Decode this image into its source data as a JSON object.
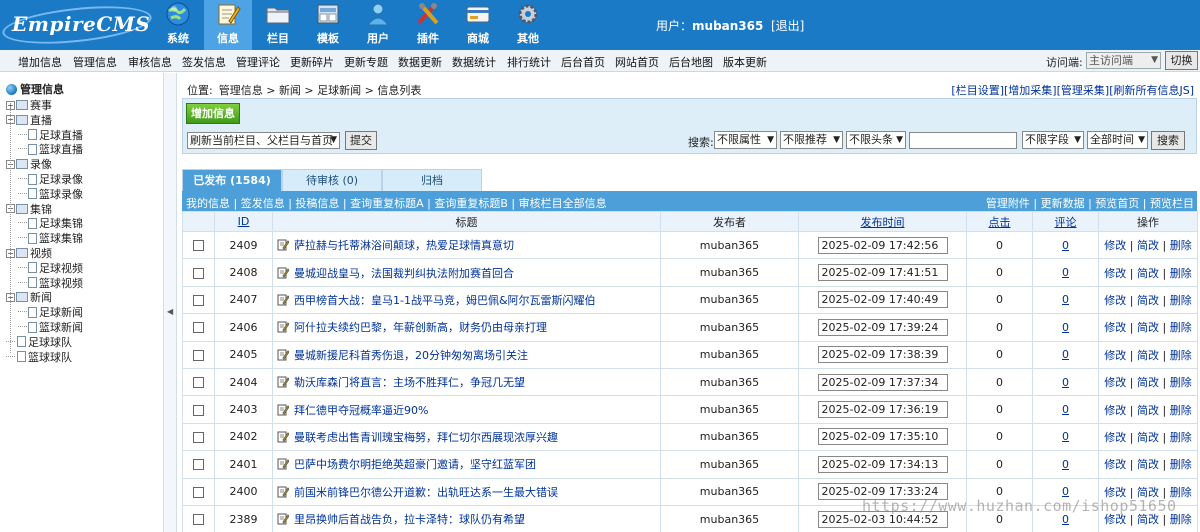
{
  "header": {
    "logo": "EmpireCMS",
    "tabs": [
      {
        "label": "系统",
        "icon": "globe-icon"
      },
      {
        "label": "信息",
        "icon": "notepad-icon"
      },
      {
        "label": "栏目",
        "icon": "folder-icon"
      },
      {
        "label": "模板",
        "icon": "template-icon"
      },
      {
        "label": "用户",
        "icon": "user-icon"
      },
      {
        "label": "插件",
        "icon": "tools-icon"
      },
      {
        "label": "商城",
        "icon": "card-icon"
      },
      {
        "label": "其他",
        "icon": "gear-icon"
      }
    ],
    "user_prefix": "用户：",
    "username": "muban365",
    "logout": "[退出]"
  },
  "menubar": {
    "items": [
      "增加信息",
      "管理信息",
      "审核信息",
      "签发信息",
      "管理评论",
      "更新碎片",
      "更新专题",
      "数据更新",
      "数据统计",
      "排行统计",
      "后台首页",
      "网站首页",
      "后台地图",
      "版本更新"
    ],
    "visit_label": "访问端:",
    "visit_value": "主访问端",
    "switch_label": "切换"
  },
  "sidebar": {
    "root": "管理信息",
    "nodes": [
      {
        "label": "赛事",
        "level": 0,
        "type": "folder-plus"
      },
      {
        "label": "直播",
        "level": 0,
        "type": "folder-minus"
      },
      {
        "label": "足球直播",
        "level": 1,
        "type": "doc"
      },
      {
        "label": "篮球直播",
        "level": 1,
        "type": "doc"
      },
      {
        "label": "录像",
        "level": 0,
        "type": "folder-minus"
      },
      {
        "label": "足球录像",
        "level": 1,
        "type": "doc"
      },
      {
        "label": "篮球录像",
        "level": 1,
        "type": "doc"
      },
      {
        "label": "集锦",
        "level": 0,
        "type": "folder-minus"
      },
      {
        "label": "足球集锦",
        "level": 1,
        "type": "doc"
      },
      {
        "label": "篮球集锦",
        "level": 1,
        "type": "doc"
      },
      {
        "label": "视频",
        "level": 0,
        "type": "folder-minus"
      },
      {
        "label": "足球视频",
        "level": 1,
        "type": "doc"
      },
      {
        "label": "篮球视频",
        "level": 1,
        "type": "doc"
      },
      {
        "label": "新闻",
        "level": 0,
        "type": "folder-minus"
      },
      {
        "label": "足球新闻",
        "level": 1,
        "type": "doc"
      },
      {
        "label": "篮球新闻",
        "level": 1,
        "type": "doc"
      },
      {
        "label": "足球球队",
        "level": 0,
        "type": "doc"
      },
      {
        "label": "篮球球队",
        "level": 0,
        "type": "doc"
      }
    ]
  },
  "location": {
    "label": "位置:",
    "crumbs": [
      "管理信息",
      "新闻",
      "足球新闻",
      "信息列表"
    ],
    "sep": " > "
  },
  "top_links": [
    "[栏目设置]",
    "[增加采集]",
    "[管理采集]",
    "[刷新所有信息JS]"
  ],
  "toolbar": {
    "add_label": "增加信息",
    "refresh_value": "刷新当前栏目、父栏目与首页",
    "submit_label": "提交",
    "search_label": "搜索:",
    "filters": [
      "不限属性",
      "不限推荐",
      "不限头条"
    ],
    "field_filter": "不限字段",
    "time_filter": "全部时间",
    "search_button": "搜索"
  },
  "tabs": [
    {
      "label": "已发布 (1584)",
      "active": true
    },
    {
      "label": "待审核 (0)",
      "active": false
    },
    {
      "label": "归档",
      "active": false
    }
  ],
  "listbar": {
    "left": [
      "我的信息",
      "签发信息",
      "投稿信息",
      "查询重复标题A",
      "查询重复标题B",
      "审核栏目全部信息"
    ],
    "right": [
      "管理附件",
      "更新数据",
      "预览首页",
      "预览栏目"
    ]
  },
  "table": {
    "headers": {
      "id": "ID",
      "title": "标题",
      "author": "发布者",
      "time": "发布时间",
      "clicks": "点击",
      "comments": "评论",
      "ops": "操作"
    },
    "ops": {
      "edit": "修改",
      "quick": "简改",
      "delete": "删除",
      "sep": " | "
    },
    "rows": [
      {
        "id": "2409",
        "title": "萨拉赫与托蒂淋浴间颠球，热爱足球情真意切",
        "author": "muban365",
        "time": "2025-02-09 17:42:56",
        "clicks": "0",
        "comments": "0"
      },
      {
        "id": "2408",
        "title": "曼城迎战皇马，法国裁判纠执法附加赛首回合",
        "author": "muban365",
        "time": "2025-02-09 17:41:51",
        "clicks": "0",
        "comments": "0"
      },
      {
        "id": "2407",
        "title": "西甲榜首大战：皇马1-1战平马竞，姆巴佩&阿尔瓦雷斯闪耀伯",
        "author": "muban365",
        "time": "2025-02-09 17:40:49",
        "clicks": "0",
        "comments": "0"
      },
      {
        "id": "2406",
        "title": "阿什拉夫续约巴黎，年薪创新高，财务仍由母亲打理",
        "author": "muban365",
        "time": "2025-02-09 17:39:24",
        "clicks": "0",
        "comments": "0"
      },
      {
        "id": "2405",
        "title": "曼城新援尼科首秀伤退，20分钟匆匆离场引关注",
        "author": "muban365",
        "time": "2025-02-09 17:38:39",
        "clicks": "0",
        "comments": "0"
      },
      {
        "id": "2404",
        "title": "勒沃库森门将直言：主场不胜拜仁，争冠几无望",
        "author": "muban365",
        "time": "2025-02-09 17:37:34",
        "clicks": "0",
        "comments": "0"
      },
      {
        "id": "2403",
        "title": "拜仁德甲夺冠概率逼近90%",
        "author": "muban365",
        "time": "2025-02-09 17:36:19",
        "clicks": "0",
        "comments": "0"
      },
      {
        "id": "2402",
        "title": "曼联考虑出售青训瑰宝梅努，拜仁切尔西展现浓厚兴趣",
        "author": "muban365",
        "time": "2025-02-09 17:35:10",
        "clicks": "0",
        "comments": "0"
      },
      {
        "id": "2401",
        "title": "巴萨中场费尔明拒绝英超豪门邀请，坚守红蓝军团",
        "author": "muban365",
        "time": "2025-02-09 17:34:13",
        "clicks": "0",
        "comments": "0"
      },
      {
        "id": "2400",
        "title": "前国米前锋巴尔德公开道歉：出轨旺达系一生最大错误",
        "author": "muban365",
        "time": "2025-02-09 17:33:24",
        "clicks": "0",
        "comments": "0"
      },
      {
        "id": "2389",
        "title": "里昂换帅后首战告负，拉卡泽特：球队仍有希望",
        "author": "muban365",
        "time": "2025-02-03 10:44:52",
        "clicks": "0",
        "comments": "0"
      }
    ]
  },
  "watermark": "https://www.huzhan.com/ishop51650",
  "colors": {
    "header": "#1b7ac6",
    "active_tab": "#4da3e3",
    "listbar": "#4c9fd8",
    "link": "#003399"
  }
}
